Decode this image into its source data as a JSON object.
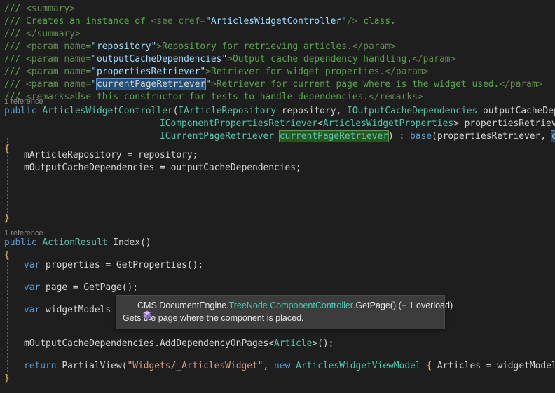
{
  "editor": {
    "background": "#1e1e1e",
    "foreground": "#d4d4d4",
    "language": "csharp",
    "codelens_label": "1 reference"
  },
  "colors": {
    "comment_green": "#57a64a",
    "doc_tag": "#608b4e",
    "keyword_blue": "#569cd6",
    "type_teal": "#4ec9b0",
    "string_orange": "#d69d85",
    "brace_gold": "#e8b765",
    "selection_blue": "#264f78",
    "reference_green": "#29551f",
    "reference_blue": "#2d4a6b",
    "tooltip_bg": "#3c3c3c"
  },
  "code": {
    "doc_comments": {
      "l1_slash": "/// ",
      "l1_tag": "<summary>",
      "l2_slash": "/// ",
      "l2_text": "Creates an instance of ",
      "l2_tag_open": "<see cref=",
      "l2_cref": "\"ArticlesWidgetController\"",
      "l2_tag_close": "/>",
      "l2_tail": " class.",
      "l3_slash": "/// ",
      "l3_tag": "</summary>",
      "l4_slash": "/// ",
      "l4_tag_open": "<param name=",
      "l4_attr": "\"repository\"",
      "l4_gt": ">",
      "l4_text": "Repository for retrieving articles.",
      "l4_tag_close": "</param>",
      "l5_slash": "/// ",
      "l5_tag_open": "<param name=",
      "l5_attr": "\"outputCacheDependencies\"",
      "l5_gt": ">",
      "l5_text": "Output cache dependency handling.",
      "l5_tag_close": "</param>",
      "l6_slash": "/// ",
      "l6_tag_open": "<param name=",
      "l6_attr": "\"propertiesRetriever\"",
      "l6_gt": ">",
      "l6_text": "Retriever for widget properties.",
      "l6_tag_close": "</param>",
      "l7_slash": "/// ",
      "l7_tag_open": "<param name=",
      "l7_quote_open": "\"",
      "l7_selected": "currentPageRetriever",
      "l7_quote_close": "\"",
      "l7_gt": ">",
      "l7_text": "Retriever for current page where is the widget used.",
      "l7_tag_close": "</param>",
      "l8_slash": "/// ",
      "l8_tag_open": "<remarks>",
      "l8_text": "Use this constructor for tests to handle dependencies.",
      "l8_tag_close": "</remarks>"
    },
    "constructor": {
      "codelens": "1 reference",
      "modifier": "public",
      "name": "ArticlesWidgetController",
      "paren_open": "(",
      "p1_type": "IArticleRepository",
      "p1_name": "repository",
      "comma1": ", ",
      "p2_type": "IOutputCacheDependencies",
      "p2_name": "outputCacheDependencies",
      "comma2": ",",
      "p3_type": "IComponentPropertiesRetriever",
      "p3_generic_open": "<",
      "p3_generic": "ArticlesWidgetProperties",
      "p3_generic_close": ">",
      "p3_name": "propertiesRetriever",
      "comma3": ",",
      "p4_type": "ICurrentPageRetriever",
      "p4_name": "currentPageRetriever",
      "paren_close": ")",
      "base_colon": " : ",
      "base_kw": "base",
      "base_open": "(",
      "base_arg1": "propertiesRetriever",
      "base_comma": ", ",
      "base_arg2": "currentPa",
      "open_brace": "{",
      "body1_lhs": "mArticleRepository",
      "body1_eq": " = ",
      "body1_rhs": "repository;",
      "body2_lhs": "mOutputCacheDependencies",
      "body2_eq": " = ",
      "body2_rhs": "outputCacheDependencies;",
      "close_brace": "}"
    },
    "index_method": {
      "codelens": "1 reference",
      "modifier": "public",
      "return_type": "ActionResult",
      "name": "Index",
      "parens": "()",
      "open_brace": "{",
      "l1_kw": "var",
      "l1_name": " properties = ",
      "l1_call": "GetProperties();",
      "l2_kw": "var",
      "l2_name": " page = ",
      "l2_call": "GetPage();",
      "l3_kw": "var",
      "l3_name": " widgetModels = ",
      "l4_obj": "mOutputCacheDependencies",
      "l4_dot": ".",
      "l4_method": "AddDependencyOnPages",
      "l4_generic_open": "<",
      "l4_generic": "Article",
      "l4_generic_close": ">",
      "l4_tail": "();",
      "l5_kw": "return",
      "l5_call": " PartialView(",
      "l5_str": "\"Widgets/_ArticlesWidget\"",
      "l5_comma": ", ",
      "l5_new": "new",
      "l5_type": " ArticlesWidgetViewModel",
      "l5_brace": " { ",
      "l5_prop1": "Articles = widgetModels, Count = ",
      "close_brace": "}"
    }
  },
  "tooltip": {
    "icon_name": "method-icon",
    "signature_namespace": "CMS.DocumentEngine.",
    "signature_type": "TreeNode ComponentController",
    "signature_member": ".GetPage() (+ 1 overload)",
    "description": "Gets the page where the component is placed."
  }
}
